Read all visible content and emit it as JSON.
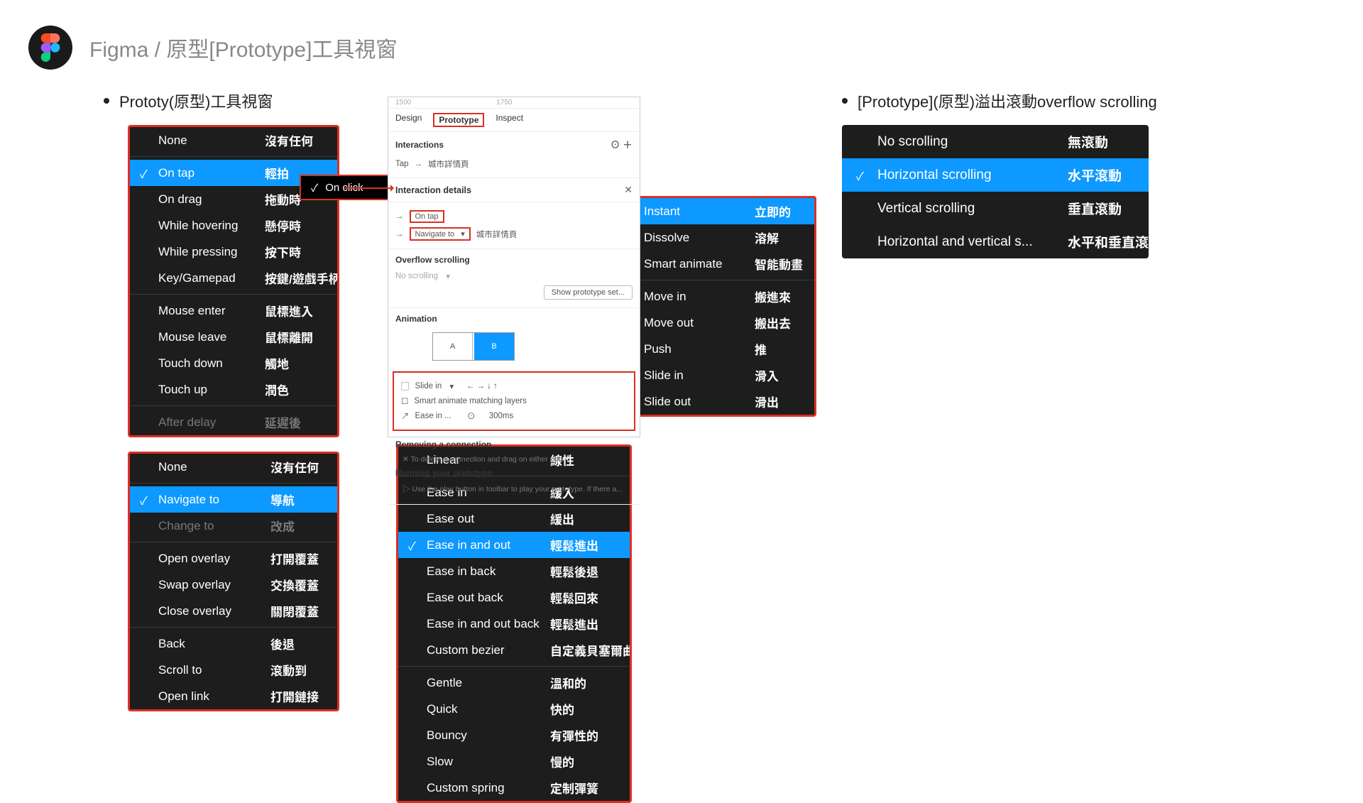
{
  "header": {
    "title": "Figma / 原型[Prototype]工具視窗"
  },
  "left_heading": "Prototy(原型)工具視窗",
  "right_heading": "[Prototype](原型)溢出滾動overflow scrolling",
  "onclick_label": "On click",
  "triggers": [
    {
      "en": "None",
      "zh": "沒有任何",
      "sel": false
    },
    {
      "sep": true
    },
    {
      "en": "On tap",
      "zh": "輕拍",
      "sel": true
    },
    {
      "en": "On drag",
      "zh": "拖動時",
      "sel": false
    },
    {
      "en": "While hovering",
      "zh": "懸停時",
      "sel": false
    },
    {
      "en": "While pressing",
      "zh": "按下時",
      "sel": false
    },
    {
      "en": "Key/Gamepad",
      "zh": "按鍵/遊戲手柄",
      "sel": false
    },
    {
      "sep": true
    },
    {
      "en": "Mouse enter",
      "zh": "鼠標進入",
      "sel": false
    },
    {
      "en": "Mouse leave",
      "zh": "鼠標離開",
      "sel": false
    },
    {
      "en": "Touch down",
      "zh": "觸地",
      "sel": false
    },
    {
      "en": "Touch up",
      "zh": "潤色",
      "sel": false
    },
    {
      "sep": true
    },
    {
      "en": "After delay",
      "zh": "延遲後",
      "sel": false,
      "dim": true
    }
  ],
  "actions": [
    {
      "en": "None",
      "zh": "沒有任何"
    },
    {
      "sep": true
    },
    {
      "en": "Navigate to",
      "zh": "導航",
      "sel": true
    },
    {
      "en": "Change to",
      "zh": "改成",
      "dim": true
    },
    {
      "sep": true
    },
    {
      "en": "Open overlay",
      "zh": "打開覆蓋"
    },
    {
      "en": "Swap overlay",
      "zh": "交換覆蓋"
    },
    {
      "en": "Close overlay",
      "zh": "關閉覆蓋"
    },
    {
      "sep": true
    },
    {
      "en": "Back",
      "zh": "後退"
    },
    {
      "en": "Scroll to",
      "zh": "滾動到"
    },
    {
      "en": "Open link",
      "zh": "打開鏈接"
    }
  ],
  "animations": [
    {
      "en": "Instant",
      "zh": "立即的",
      "sel": true
    },
    {
      "en": "Dissolve",
      "zh": "溶解"
    },
    {
      "en": "Smart animate",
      "zh": "智能動畫"
    },
    {
      "sep": true
    },
    {
      "en": "Move in",
      "zh": "搬進來"
    },
    {
      "en": "Move out",
      "zh": "搬出去"
    },
    {
      "en": "Push",
      "zh": "推"
    },
    {
      "en": "Slide in",
      "zh": "滑入"
    },
    {
      "en": "Slide out",
      "zh": "滑出"
    }
  ],
  "easings": [
    {
      "en": "Linear",
      "zh": "線性"
    },
    {
      "sep": true
    },
    {
      "en": "Ease in",
      "zh": "緩入"
    },
    {
      "en": "Ease out",
      "zh": "緩出"
    },
    {
      "en": "Ease in and out",
      "zh": "輕鬆進出",
      "sel": true
    },
    {
      "en": "Ease in back",
      "zh": "輕鬆後退"
    },
    {
      "en": "Ease out back",
      "zh": "輕鬆回來"
    },
    {
      "en": "Ease in and out back",
      "zh": "輕鬆進出"
    },
    {
      "en": "Custom bezier",
      "zh": "自定義貝塞爾曲線"
    },
    {
      "sep": true
    },
    {
      "en": "Gentle",
      "zh": "溫和的"
    },
    {
      "en": "Quick",
      "zh": "快的"
    },
    {
      "en": "Bouncy",
      "zh": "有彈性的"
    },
    {
      "en": "Slow",
      "zh": "慢的"
    },
    {
      "en": "Custom spring",
      "zh": "定制彈簧"
    }
  ],
  "overflow": [
    {
      "en": "No scrolling",
      "zh": "無滾動"
    },
    {
      "en": "Horizontal scrolling",
      "zh": "水平滾動",
      "sel": true
    },
    {
      "en": "Vertical scrolling",
      "zh": "垂直滾動"
    },
    {
      "en": "Horizontal and vertical s...",
      "zh": "水平和垂直滾動"
    }
  ],
  "proto": {
    "ruler": [
      "1500",
      "1750"
    ],
    "tabs": [
      "Design",
      "Prototype",
      "Inspect"
    ],
    "interactions": "Interactions",
    "interaction_details": "Interaction details",
    "tap": "Tap",
    "tap_target": "城市詳情頁",
    "on_tap": "On tap",
    "navigate_to": "Navigate to",
    "nav_target": "城市詳情頁",
    "animation": "Animation",
    "frame_a": "A",
    "frame_b": "B",
    "slide_in": "Slide in",
    "dirs": "← → ↓ ↑",
    "smart_match": "Smart animate matching layers",
    "ease_in": "Ease in ...",
    "duration": "300ms",
    "overflow_hd": "Overflow scrolling",
    "no_scroll": "No scrolling",
    "show_proto": "Show prototype set...",
    "remove_hd": "Removing a connection",
    "remove_txt": "To delete a connection and drag on either end",
    "run_hd": "Running your prototype",
    "run_txt": "Use the play button in toolbar to play your prototype. If there a..."
  }
}
